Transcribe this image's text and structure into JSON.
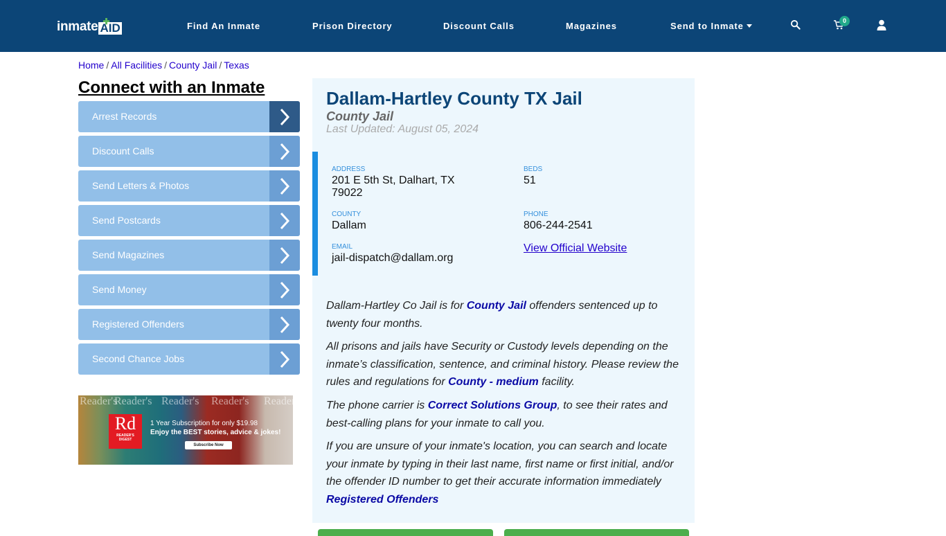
{
  "navbar": {
    "logo_left": "inmate",
    "logo_right": "AID",
    "items": [
      {
        "label": "Find An Inmate"
      },
      {
        "label": "Prison Directory"
      },
      {
        "label": "Discount Calls"
      },
      {
        "label": "Magazines"
      },
      {
        "label": "Send to Inmate",
        "dropdown": true
      }
    ],
    "icons": [
      "search-icon",
      "cart-icon",
      "user-icon"
    ],
    "cart_count": "0"
  },
  "breadcrumb": [
    {
      "label": "Home"
    },
    {
      "label": "All Facilities"
    },
    {
      "label": "County Jail"
    },
    {
      "label": "Texas"
    }
  ],
  "breadcrumb_separator": "/",
  "sidebar": {
    "title": "Connect with an Inmate",
    "items": [
      {
        "label": "Arrest Records"
      },
      {
        "label": "Discount Calls"
      },
      {
        "label": "Send Letters & Photos"
      },
      {
        "label": "Send Postcards"
      },
      {
        "label": "Send Magazines"
      },
      {
        "label": "Send Money"
      },
      {
        "label": "Registered Offenders"
      },
      {
        "label": "Second Chance Jobs"
      }
    ]
  },
  "ad": {
    "brand": "Rd",
    "brand_sub1": "READER'S",
    "brand_sub2": "DIGEST",
    "masthead": "Reader's",
    "line1": "1 Year Subscription for only $19.98",
    "line2": "Enjoy the BEST stories, advice & jokes!",
    "button": "Subscribe Now"
  },
  "facility": {
    "title": "Dallam-Hartley County TX Jail",
    "type": "County Jail",
    "updated": "Last Updated: August 05, 2024",
    "info": {
      "address_label": "ADDRESS",
      "address_line1": "201 E 5th St, Dalhart, TX",
      "address_line2": "79022",
      "beds_label": "BEDS",
      "beds": "51",
      "county_label": "COUNTY",
      "county": "Dallam",
      "phone_label": "PHONE",
      "phone": "806-244-2541",
      "email_label": "EMAIL",
      "email": "jail-dispatch@dallam.org",
      "website_link": "View Official Website"
    },
    "description": {
      "p1_a": "Dallam-Hartley Co Jail is for ",
      "p1_link": "County Jail",
      "p1_b": " offenders sentenced up to twenty four months.",
      "p2_a": "All prisons and jails have Security or Custody levels depending on the inmate’s classification, sentence, and criminal history. Please review the rules and regulations for ",
      "p2_link": "County - medium",
      "p2_b": " facility.",
      "p3_a": "The phone carrier is ",
      "p3_link": "Correct Solutions Group",
      "p3_b": ", to see their rates and best-calling plans for your inmate to call you.",
      "p4": "If you are unsure of your inmate's location, you can search and locate your inmate by typing in their last name, first name or first initial, and/or the offender ID number to get their accurate information immediately",
      "p4_link": "Registered Offenders"
    }
  }
}
